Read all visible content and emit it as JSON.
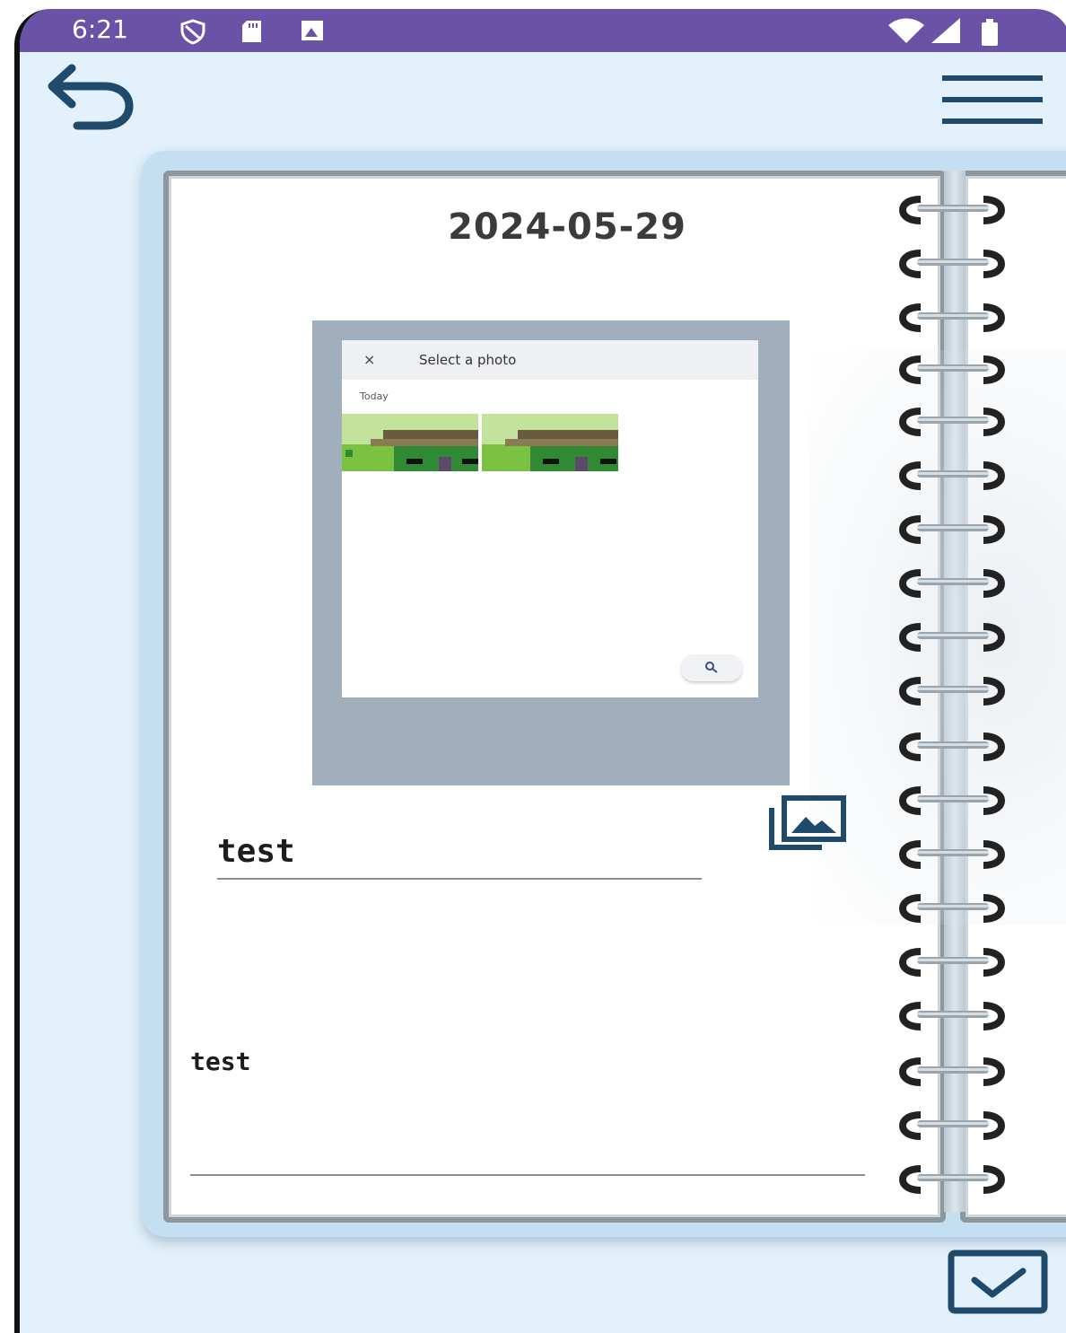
{
  "status_bar": {
    "time": "6:21",
    "background": "#6a52a6",
    "left_icons": [
      "shield-icon",
      "sd-card-icon",
      "image-notification-icon"
    ],
    "right_icons": [
      "wifi-icon",
      "cell-signal-icon",
      "battery-icon"
    ]
  },
  "toolbar": {
    "back_icon": "undo-arrow-icon",
    "menu_icon": "hamburger-menu-icon",
    "icon_color": "#1f4a6b"
  },
  "entry": {
    "date": "2024-05-29",
    "title": "test",
    "body": "test"
  },
  "attached_photo": {
    "picker_close": "×",
    "picker_title": "Select a photo",
    "section_label": "Today",
    "thumbnails": [
      "photo-thumbnail-1",
      "photo-thumbnail-2"
    ],
    "frame_color": "#a1aebb"
  },
  "actions": {
    "gallery_icon": "photo-library-icon",
    "save_icon": "checkbox-check-icon"
  },
  "colors": {
    "background": "#e2f1fb",
    "accent": "#1f4a6b",
    "page": "#ffffff",
    "page_border": "#8e979e"
  }
}
